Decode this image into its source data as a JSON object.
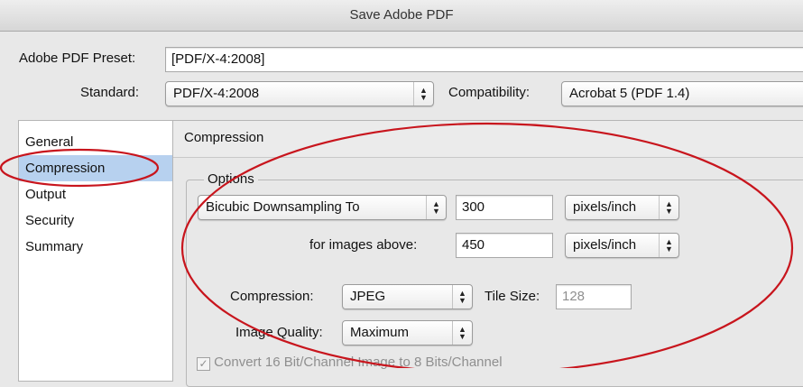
{
  "window": {
    "title": "Save Adobe PDF"
  },
  "preset": {
    "label": "Adobe PDF Preset:",
    "value": "[PDF/X-4:2008]"
  },
  "standard": {
    "label": "Standard:",
    "value": "PDF/X-4:2008"
  },
  "compatibility": {
    "label": "Compatibility:",
    "value": "Acrobat 5 (PDF 1.4)"
  },
  "sidebar": {
    "items": [
      {
        "label": "General"
      },
      {
        "label": "Compression"
      },
      {
        "label": "Output"
      },
      {
        "label": "Security"
      },
      {
        "label": "Summary"
      }
    ]
  },
  "section": {
    "title": "Compression"
  },
  "options": {
    "legend": "Options",
    "downsampling": {
      "value": "Bicubic Downsampling To",
      "resolution": "300",
      "unit": "pixels/inch"
    },
    "above": {
      "label": "for images above:",
      "resolution": "450",
      "unit": "pixels/inch"
    },
    "compression": {
      "label": "Compression:",
      "value": "JPEG"
    },
    "tile_size": {
      "label": "Tile Size:",
      "value": "128"
    },
    "quality": {
      "label": "Image Quality:",
      "value": "Maximum"
    },
    "convert": {
      "label": "Convert 16 Bit/Channel Image to 8 Bits/Channel",
      "checked": true
    }
  },
  "colors": {
    "annotation": "#c8151d",
    "selection": "#b7d1ef"
  }
}
